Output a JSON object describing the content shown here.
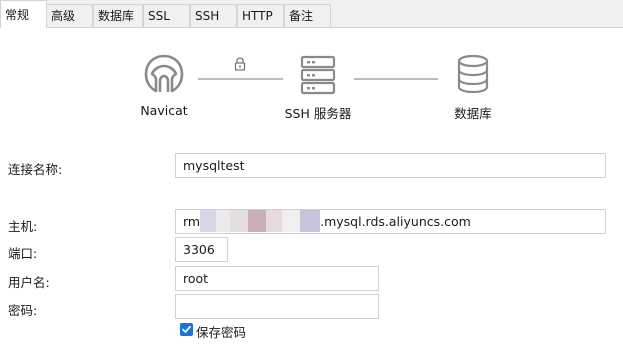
{
  "tabs": [
    {
      "label": "常规",
      "active": true
    },
    {
      "label": "高级"
    },
    {
      "label": "数据库"
    },
    {
      "label": "SSL"
    },
    {
      "label": "SSH"
    },
    {
      "label": "HTTP"
    },
    {
      "label": "备注"
    }
  ],
  "diagram": {
    "client_label": "Navicat",
    "server_label": "SSH 服务器",
    "database_label": "数据库",
    "icons": [
      "navicat-logo-icon",
      "lock-icon",
      "server-icon",
      "database-icon"
    ]
  },
  "form": {
    "connection_name_label": "连接名称:",
    "connection_name_value": "mysqltest",
    "host_label": "主机:",
    "host_prefix": "rm",
    "host_suffix": ".mysql.rds.aliyuncs.com",
    "port_label": "端口:",
    "port_value": "3306",
    "username_label": "用户名:",
    "username_value": "root",
    "password_label": "密码:",
    "password_value": "",
    "save_password_label": "保存密码",
    "save_password_checked": true
  },
  "colors": {
    "accent": "#1a73d9",
    "icon_gray": "#8a8a8a",
    "redaction_blocks": [
      "#d9d5e8",
      "#ece8ec",
      "#e3dedf",
      "#c9aeb7",
      "#e6dadd",
      "#f0eef0",
      "#c7c3da"
    ]
  }
}
